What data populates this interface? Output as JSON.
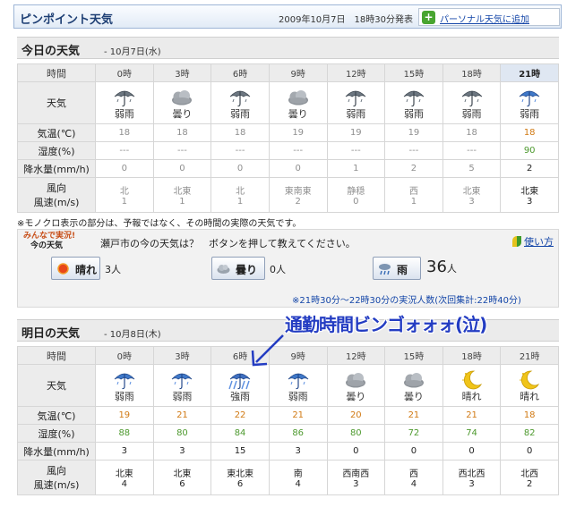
{
  "header": {
    "title": "ピンポイント天気",
    "issued": "2009年10月7日　18時30分発表",
    "add_label": "パーソナル天気に追加"
  },
  "today": {
    "title": "今日の天気",
    "date": "- 10月7日(水)",
    "labels": {
      "time": "時間",
      "weather": "天気",
      "temp": "気温(℃)",
      "humidity": "湿度(%)",
      "precip": "降水量(mm/h)",
      "wind_dir": "風向",
      "wind_speed": "風速(m/s)"
    },
    "hours": [
      "0時",
      "3時",
      "6時",
      "9時",
      "12時",
      "15時",
      "18時",
      "21時"
    ],
    "weather": [
      "弱雨",
      "曇り",
      "弱雨",
      "曇り",
      "弱雨",
      "弱雨",
      "弱雨",
      "弱雨"
    ],
    "icons": [
      "umbrella-icon",
      "cloud-icon",
      "umbrella-icon",
      "cloud-icon",
      "umbrella-icon",
      "umbrella-icon",
      "umbrella-icon",
      "umbrella-icon"
    ],
    "temp": [
      "18",
      "18",
      "18",
      "19",
      "19",
      "19",
      "18",
      "18"
    ],
    "humidity": [
      "---",
      "---",
      "---",
      "---",
      "---",
      "---",
      "---",
      "90"
    ],
    "precip": [
      "0",
      "0",
      "0",
      "0",
      "1",
      "2",
      "5",
      "2"
    ],
    "wind_dir": [
      "北",
      "北東",
      "北",
      "東南東",
      "静穏",
      "西",
      "北東",
      "北東"
    ],
    "wind_speed": [
      "1",
      "1",
      "1",
      "2",
      "0",
      "1",
      "3",
      "3"
    ]
  },
  "note": "※モノクロ表示の部分は、予報ではなく、その時間の実際の天気です。",
  "live": {
    "badge_top": "みんなで実況!",
    "badge_bottom": "今の天気",
    "question": "瀬戸市の今の天気は？　ボタンを押して教えてください。",
    "help": "使い方",
    "sunny": {
      "label": "晴れ",
      "count": "3人"
    },
    "cloudy": {
      "label": "曇り",
      "count": "0人"
    },
    "rain": {
      "label": "雨",
      "count_num": "36",
      "count_unit": "人"
    },
    "footer": "※21時30分～22時30分の実況人数(次回集計:22時40分)"
  },
  "annotation": "通勤時間ビンゴォォォ(泣)",
  "tomorrow": {
    "title": "明日の天気",
    "date": "- 10月8日(木)",
    "labels": {
      "time": "時間",
      "weather": "天気",
      "temp": "気温(℃)",
      "humidity": "湿度(%)",
      "precip": "降水量(mm/h)",
      "wind_dir": "風向",
      "wind_speed": "風速(m/s)"
    },
    "hours": [
      "0時",
      "3時",
      "6時",
      "9時",
      "12時",
      "15時",
      "18時",
      "21時"
    ],
    "weather": [
      "弱雨",
      "弱雨",
      "強雨",
      "弱雨",
      "曇り",
      "曇り",
      "晴れ",
      "晴れ"
    ],
    "icons": [
      "umbrella-icon",
      "umbrella-icon",
      "heavy-rain-icon",
      "umbrella-icon",
      "cloud-icon",
      "cloud-icon",
      "moon-icon",
      "moon-icon"
    ],
    "temp": [
      "19",
      "21",
      "22",
      "21",
      "20",
      "21",
      "21",
      "18"
    ],
    "humidity": [
      "88",
      "80",
      "84",
      "86",
      "80",
      "72",
      "74",
      "82"
    ],
    "precip": [
      "3",
      "3",
      "15",
      "3",
      "0",
      "0",
      "0",
      "0"
    ],
    "wind_dir": [
      "北東",
      "北東",
      "東北東",
      "南",
      "西南西",
      "西",
      "西北西",
      "北西"
    ],
    "wind_speed": [
      "4",
      "6",
      "6",
      "4",
      "3",
      "4",
      "3",
      "2"
    ]
  },
  "colors": {
    "brand": "#1e3f74",
    "temp": "#d17a14",
    "humidity": "#4e9a2f",
    "annotation": "#233cc2",
    "link": "#1446a8"
  }
}
